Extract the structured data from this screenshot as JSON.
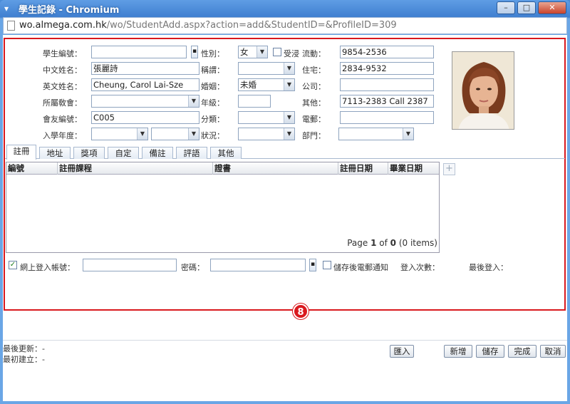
{
  "window": {
    "title": "學生記錄 - Chromium",
    "minimize": "–",
    "maximize": "□",
    "close": "✕"
  },
  "url": {
    "host": "wo.almega.com.hk",
    "path": "/wo/StudentAdd.aspx?action=add&StudentID=&ProfileID=309"
  },
  "form": {
    "student_no": {
      "label": "學生編號：",
      "value": ""
    },
    "chinese_name": {
      "label": "中文姓名：",
      "value": "張麗詩"
    },
    "english_name": {
      "label": "英文姓名：",
      "value": "Cheung, Carol Lai-Sze"
    },
    "branch": {
      "label": "所屬敎會：",
      "value": ""
    },
    "member_no": {
      "label": "會友編號：",
      "value": "C005"
    },
    "entry_year": {
      "label": "入學年度：",
      "value": ""
    },
    "gender": {
      "label": "性別：",
      "value": "女"
    },
    "baptized": {
      "label": "受浸",
      "checked": false
    },
    "title": {
      "label": "稱謂：",
      "value": ""
    },
    "marital": {
      "label": "婚姻：",
      "value": "未婚"
    },
    "grade": {
      "label": "年級：",
      "value": ""
    },
    "category": {
      "label": "分類：",
      "value": ""
    },
    "status": {
      "label": "狀況：",
      "value": ""
    },
    "mobile": {
      "label": "流動：",
      "value": "9854-2536"
    },
    "home": {
      "label": "住宅：",
      "value": "2834-9532"
    },
    "company": {
      "label": "公司：",
      "value": ""
    },
    "other": {
      "label": "其他：",
      "value": "7113-2383 Call 2387"
    },
    "email": {
      "label": "電郵：",
      "value": ""
    },
    "department": {
      "label": "部門：",
      "value": ""
    }
  },
  "tabs": [
    "註冊",
    "地址",
    "獎項",
    "自定",
    "備註",
    "評語",
    "其他"
  ],
  "grid": {
    "columns": [
      "編號",
      "註冊課程",
      "證書",
      "註冊日期",
      "畢業日期"
    ],
    "pager_prefix": "Page ",
    "pager_page": "1",
    "pager_of": " of ",
    "pager_total": "0",
    "pager_items": " (0 items)"
  },
  "login": {
    "account_label": "網上登入帳號：",
    "account_checked": true,
    "password_label": "密碼：",
    "email_notify_label": "儲存後電郵通知",
    "login_count_label": "登入次數：",
    "last_login_label": "最後登入："
  },
  "callout": "8",
  "footer": {
    "last_update": "最後更新：-",
    "created": "最初建立：-",
    "import_button": "匯入",
    "new_button": "新增",
    "save_button": "儲存",
    "done_button": "完成",
    "cancel_button": "取消"
  },
  "colors": {
    "highlight": "#d9191e",
    "titlebar": "#3f7fd0"
  }
}
